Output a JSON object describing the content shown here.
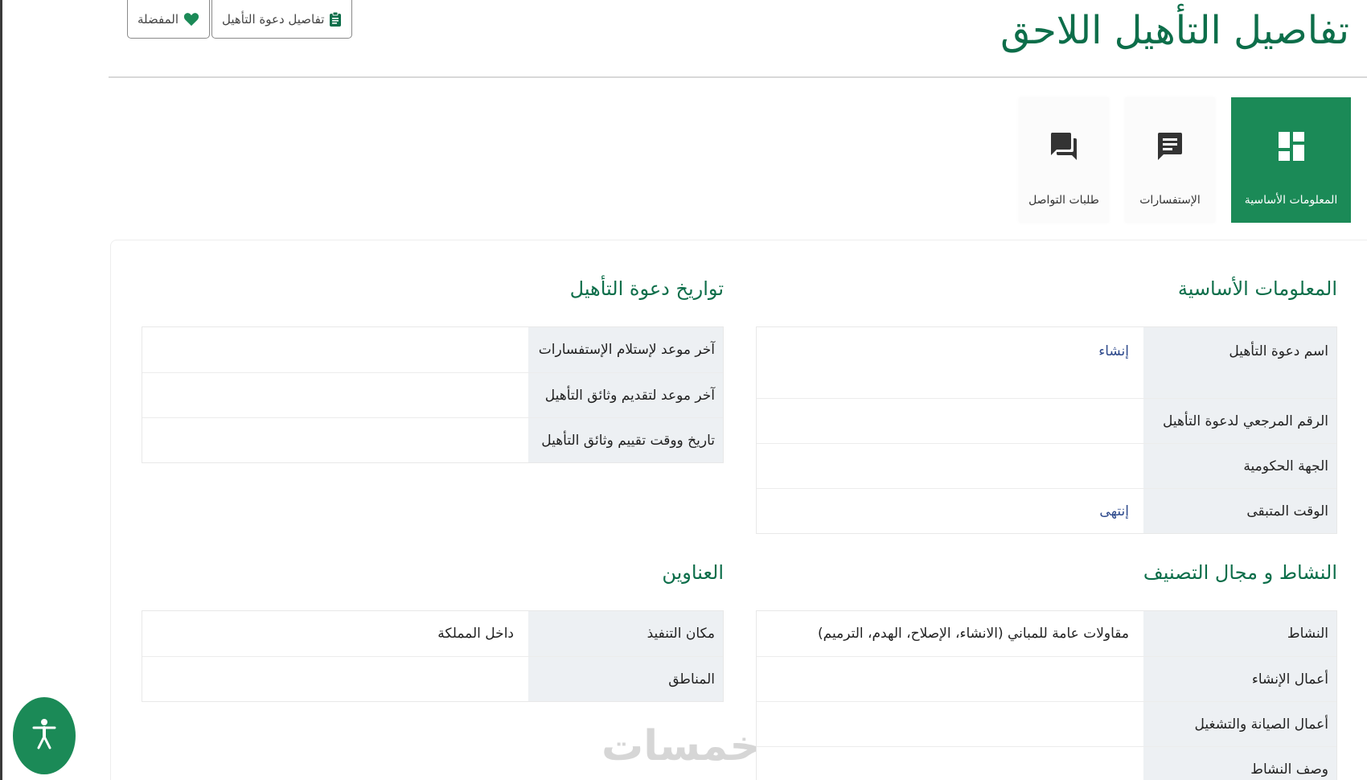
{
  "page": {
    "title": "تفاصيل التأهيل اللاحق",
    "watermark": "خمسات"
  },
  "top_actions": {
    "details_label": "تفاصيل دعوة التأهيل",
    "favorites_label": "المفضلة"
  },
  "tabs": [
    {
      "label": "المعلومات الأساسية",
      "icon": "dashboard-icon",
      "active": true
    },
    {
      "label": "الإستفسارات",
      "icon": "chat-message-icon",
      "active": false
    },
    {
      "label": "طلبات التواصل",
      "icon": "forum-icon",
      "active": false
    }
  ],
  "basic_info": {
    "title": "المعلومات الأساسية",
    "rows": [
      {
        "label": "اسم دعوة التأهيل",
        "value": "إنشاء"
      },
      {
        "label": "الرقم المرجعي لدعوة التأهيل",
        "value": ""
      },
      {
        "label": "الجهة الحكومية",
        "value": ""
      },
      {
        "label": "الوقت المتبقى",
        "value": "إنتهى"
      }
    ]
  },
  "dates": {
    "title": "تواريخ دعوة التأهيل",
    "rows": [
      {
        "label": "آخر موعد لإستلام الإستفسارات",
        "value": ""
      },
      {
        "label": "آخر موعد لتقديم وثائق التأهيل",
        "value": ""
      },
      {
        "label": "تاريخ ووقت تقييم وثائق التأهيل",
        "value": ""
      }
    ]
  },
  "activity": {
    "title": "النشاط و مجال التصنيف",
    "rows": [
      {
        "label": "النشاط",
        "value": "مقاولات عامة للمباني (الانشاء، الإصلاح، الهدم، الترميم)"
      },
      {
        "label": "أعمال الإنشاء",
        "value": ""
      },
      {
        "label": "أعمال الصيانة والتشغيل",
        "value": ""
      },
      {
        "label": "وصف النشاط",
        "value": ""
      }
    ]
  },
  "addresses": {
    "title": "العناوين",
    "rows": [
      {
        "label": "مكان التنفيذ",
        "value": "داخل المملكة"
      },
      {
        "label": "المناطق",
        "value": ""
      }
    ]
  },
  "accessibility": {
    "icon": "accessibility-icon"
  },
  "colors": {
    "brand_green": "#1b8a57",
    "title_green": "#0d6e4a",
    "label_bg": "#edf0f3",
    "value_blue": "#2e4a8c"
  }
}
